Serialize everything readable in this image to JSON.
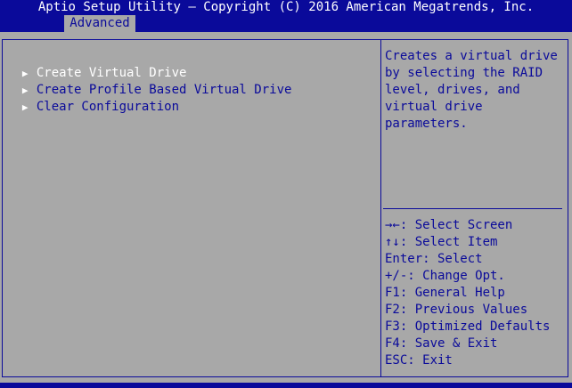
{
  "header": {
    "title": "Aptio Setup Utility – Copyright (C) 2016 American Megatrends, Inc.",
    "active_tab": "Advanced"
  },
  "menu": {
    "items": [
      {
        "label": "Create Virtual Drive",
        "selected": true
      },
      {
        "label": "Create Profile Based Virtual Drive",
        "selected": false
      },
      {
        "label": "Clear Configuration",
        "selected": false
      }
    ]
  },
  "help": {
    "lines": [
      "Creates a virtual drive",
      "by selecting the RAID",
      "level, drives, and",
      "virtual drive",
      "parameters."
    ]
  },
  "keys": {
    "lines": [
      "→←: Select Screen",
      "↑↓: Select Item",
      "Enter: Select",
      "+/-: Change Opt.",
      "F1: General Help",
      "F2: Previous Values",
      "F3: Optimized Defaults",
      "F4: Save & Exit",
      "ESC: Exit"
    ]
  },
  "colors": {
    "background": "#a8a8a8",
    "accent_blue": "#0a0a9a",
    "highlight_white": "#ffffff"
  }
}
